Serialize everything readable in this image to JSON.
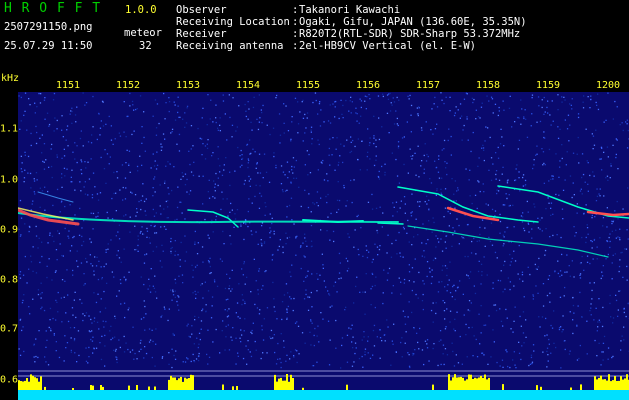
{
  "app": {
    "name": "H R O F F T",
    "version": "1.0.0"
  },
  "file": {
    "filename": "2507291150.png",
    "datetime": "25.07.29 11:50"
  },
  "meteor": {
    "label": "meteor",
    "count": "32"
  },
  "metadata": [
    {
      "label": "Observer",
      "value": "Takanori Kawachi"
    },
    {
      "label": "Receiving Location",
      "value": "Ogaki, Gifu, JAPAN (136.60E, 35.35N)"
    },
    {
      "label": "Receiver",
      "value": "R820T2(RTL-SDR) SDR-Sharp 53.372MHz"
    },
    {
      "label": "Receiving antenna",
      "value": "2el-HB9CV Vertical (el. E-W)"
    }
  ],
  "separator": ":",
  "axis": {
    "unit": "kHz",
    "time_ticks": [
      "1151",
      "1152",
      "1153",
      "1154",
      "1155",
      "1156",
      "1157",
      "1158",
      "1159",
      "1200"
    ],
    "freq_ticks": [
      "1.1",
      "1.0",
      "0.9",
      "0.8",
      "0.7",
      "0.6"
    ]
  },
  "colors": {
    "background": "#000000",
    "header_text": "#00d000",
    "version_text": "#ffff30",
    "axis_text": "#ffff30",
    "spectrogram_bg": "#0a0a6e",
    "echo": "#00ffc8",
    "strong_echo": "#ff5050",
    "level_bar": "#ffff00",
    "baseline": "#00e0ff"
  }
}
